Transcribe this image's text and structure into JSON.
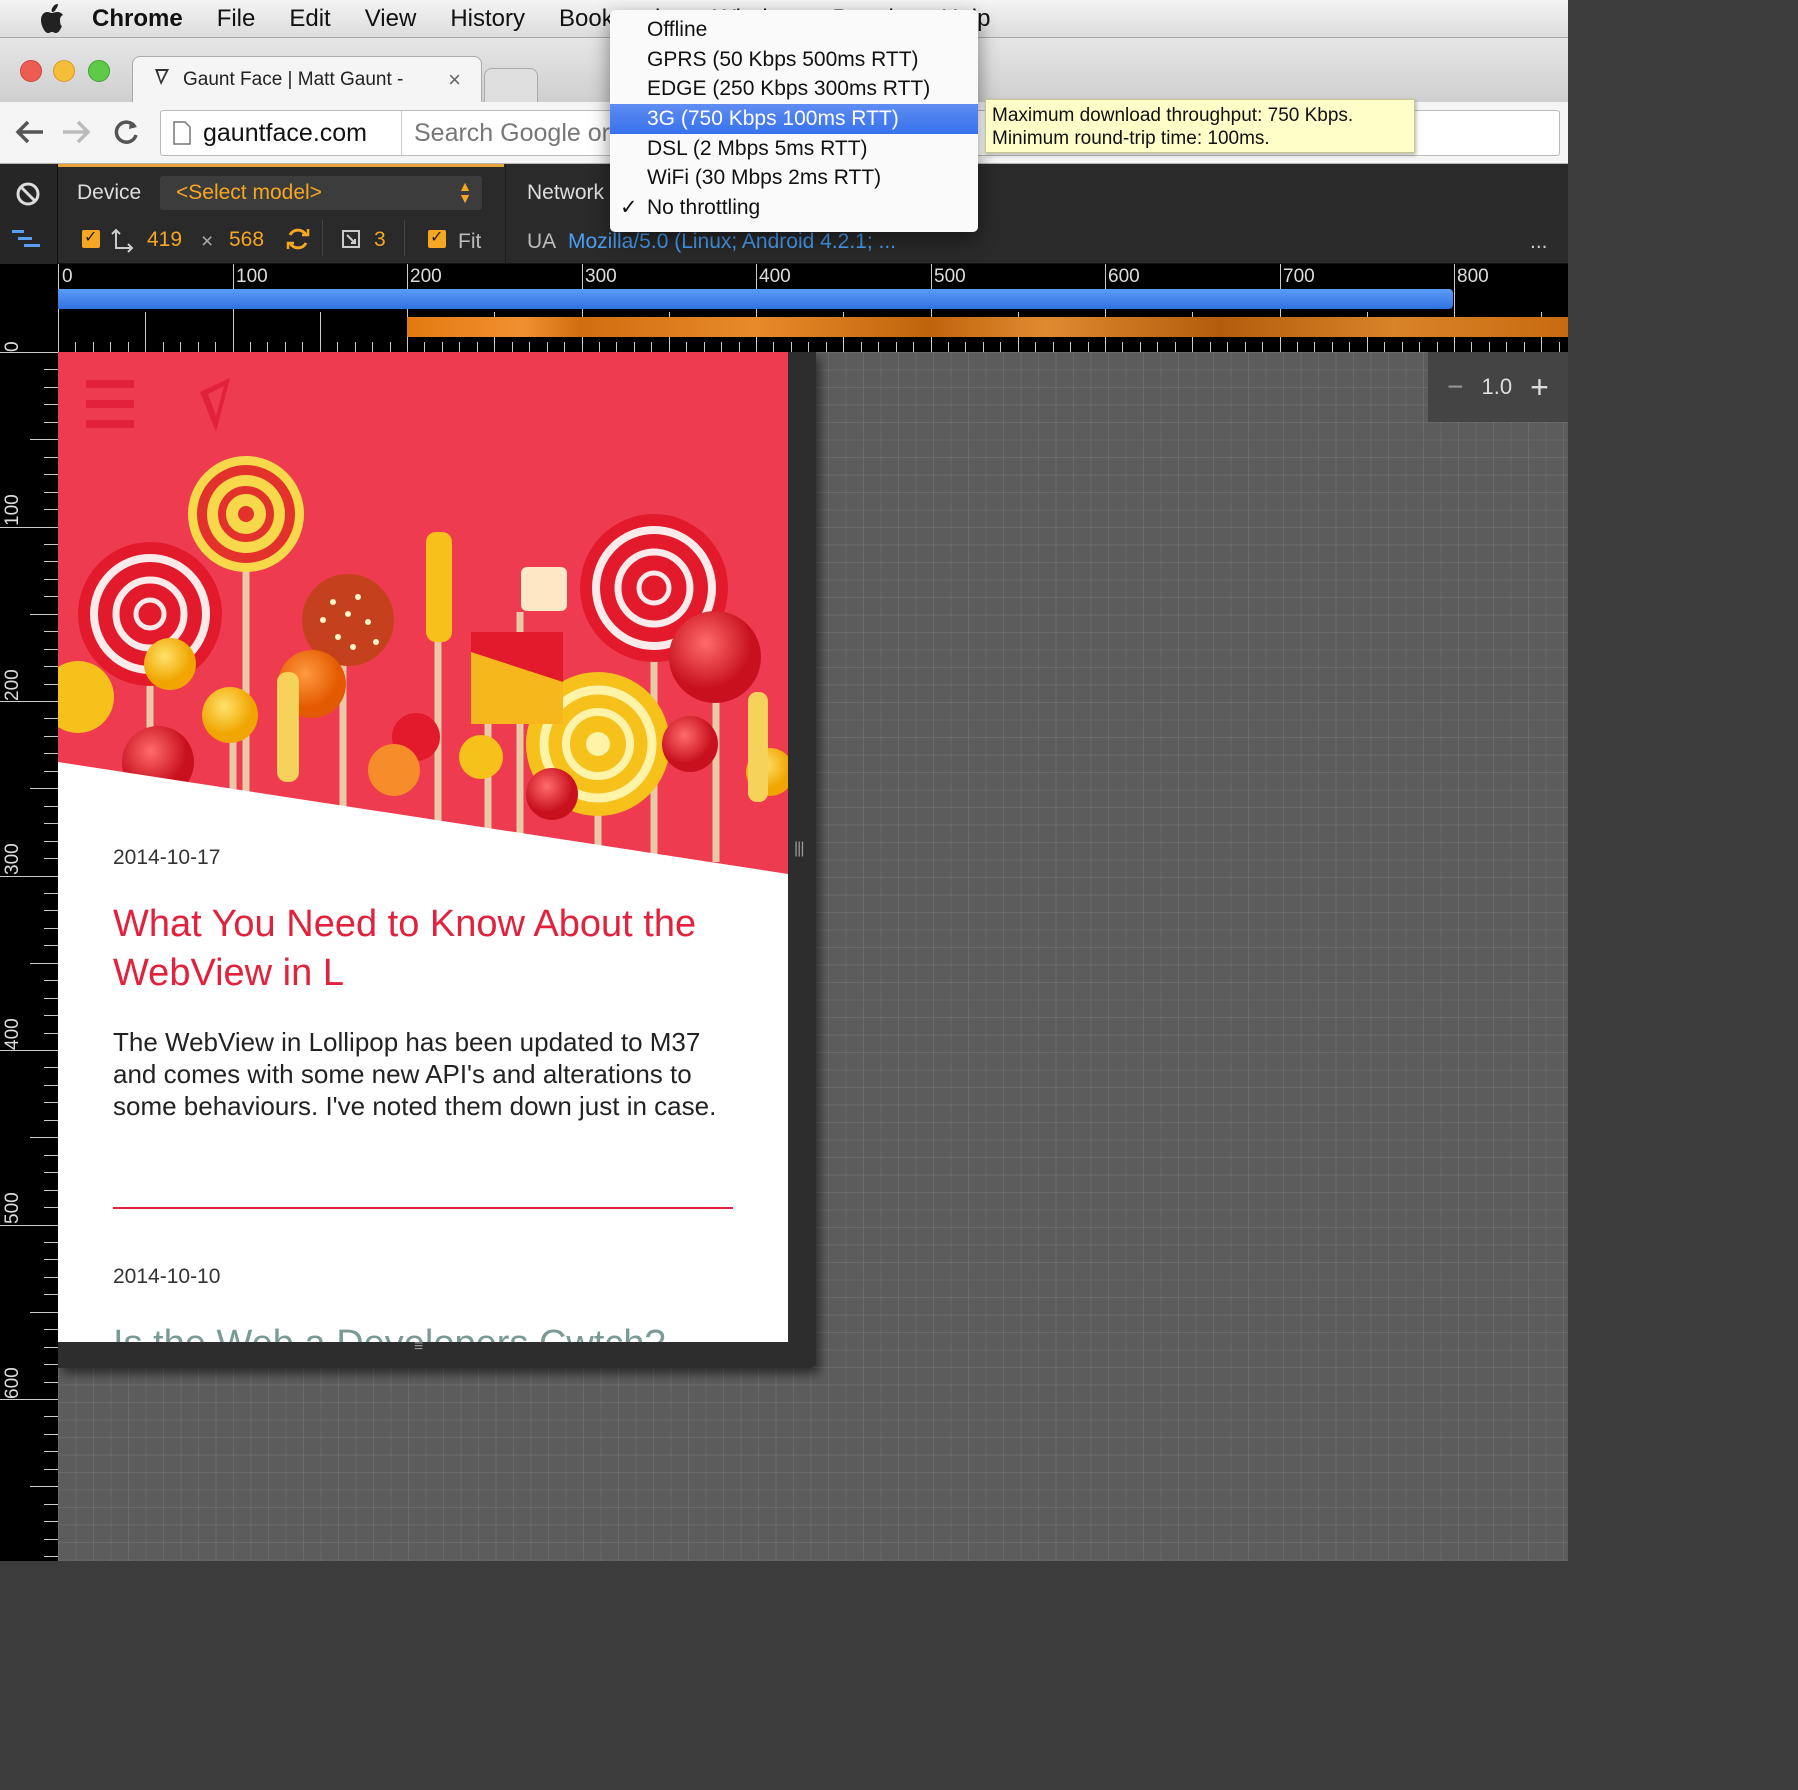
{
  "menubar": {
    "items": [
      "Chrome",
      "File",
      "Edit",
      "View",
      "History",
      "Bookmarks",
      "Window",
      "People",
      "Help"
    ]
  },
  "tab": {
    "title": "Gaunt Face | Matt Gaunt -"
  },
  "omnibox": {
    "url": "gauntface.com",
    "search_placeholder": "Search Google or"
  },
  "emulation": {
    "device_label": "Device",
    "device_select": "<Select model>",
    "width": "419",
    "times": "×",
    "height": "568",
    "dpr": "3",
    "fit_label": "Fit",
    "network_label": "Network",
    "ua_label": "UA",
    "ua_value": "Mozilla/5.0 (Linux; Android 4.2.1; ...",
    "more": "..."
  },
  "rulers": {
    "h": [
      "0",
      "100",
      "200",
      "300",
      "400",
      "500",
      "600",
      "700",
      "800"
    ],
    "v": [
      "0",
      "100",
      "200",
      "300",
      "400",
      "500",
      "600"
    ]
  },
  "network_menu": {
    "items": [
      {
        "label": "Offline",
        "checked": false,
        "highlighted": false
      },
      {
        "label": "GPRS (50 Kbps 500ms RTT)",
        "checked": false,
        "highlighted": false
      },
      {
        "label": "EDGE (250 Kbps 300ms RTT)",
        "checked": false,
        "highlighted": false
      },
      {
        "label": "3G (750 Kbps 100ms RTT)",
        "checked": false,
        "highlighted": true
      },
      {
        "label": "DSL (2 Mbps 5ms RTT)",
        "checked": false,
        "highlighted": false
      },
      {
        "label": "WiFi (30 Mbps 2ms RTT)",
        "checked": false,
        "highlighted": false
      },
      {
        "label": "No throttling",
        "checked": true,
        "highlighted": false
      }
    ]
  },
  "tooltip": {
    "line1": "Maximum download throughput: 750 Kbps.",
    "line2": "Minimum round-trip time: 100ms."
  },
  "zoom": {
    "minus": "−",
    "value": "1.0",
    "plus": "+"
  },
  "page": {
    "posts": [
      {
        "date": "2014-10-17",
        "title": "What You Need to Know About the WebView in L",
        "excerpt": "The WebView in Lollipop has been updated to M37 and comes with some new API's and alterations to some behaviours. I've noted them down just in case."
      },
      {
        "date": "2014-10-10",
        "title": "Is the Web a Developers Cwtch?"
      }
    ]
  },
  "colors": {
    "accent": "#e2213c",
    "orange": "#f5a623",
    "highlight": "#3b75ee"
  }
}
